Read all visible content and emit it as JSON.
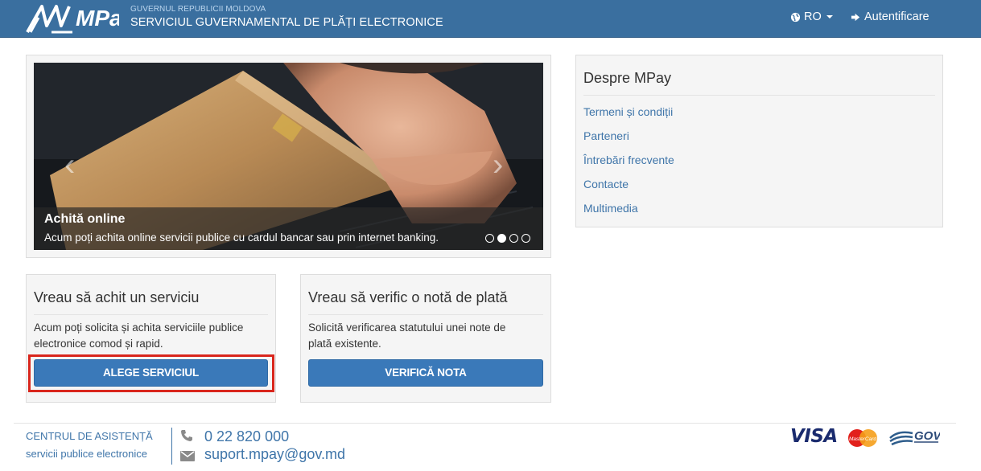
{
  "header": {
    "logo_text": "MPay",
    "gov_small": "GUVERNUL REPUBLICII MOLDOVA",
    "gov_big": "SERVICIUL GUVERNAMENTAL DE PLĂȚI ELECTRONICE",
    "lang_label": "RO",
    "lang_icon": "globe-icon",
    "login_label": "Autentificare",
    "login_icon": "sign-in-icon",
    "color": "#3a6f9f"
  },
  "carousel": {
    "title": "Achită online",
    "text": "Acum poți achita online servicii publice cu cardul bancar sau prin internet banking.",
    "prev_icon": "chevron-left-icon",
    "prev_glyph": "‹",
    "next_icon": "chevron-right-icon",
    "next_glyph": "›",
    "slide_count": 4,
    "active_slide": 2
  },
  "despre": {
    "title": "Despre MPay",
    "links": [
      "Termeni și condiții",
      "Parteneri",
      "Întrebări frecvente",
      "Contacte",
      "Multimedia"
    ]
  },
  "box_pay": {
    "title": "Vreau să achit un serviciu",
    "text_line1": "Acum poți solicita și achita serviciile publice",
    "text_line2": "electronice comod și rapid.",
    "button": "ALEGE SERVICIUL"
  },
  "box_verify": {
    "title": "Vreau să verific o notă de plată",
    "text_line1": "Solicită verificarea statutului unei note de",
    "text_line2": "plată existente.",
    "button": "VERIFICĂ NOTA"
  },
  "footer": {
    "center_title": "CENTRUL DE ASISTENȚĂ",
    "center_sub": "servicii publice electronice",
    "phone": "0 22 820 000",
    "email": "suport.mpay@gov.md",
    "phone_icon": "phone-icon",
    "email_icon": "envelope-icon",
    "visa": "VISA",
    "mastercard_text": "MasterCard",
    "mgov_text": "GOV"
  },
  "accent": "#3a79b9",
  "highlight_color": "#d9261c"
}
